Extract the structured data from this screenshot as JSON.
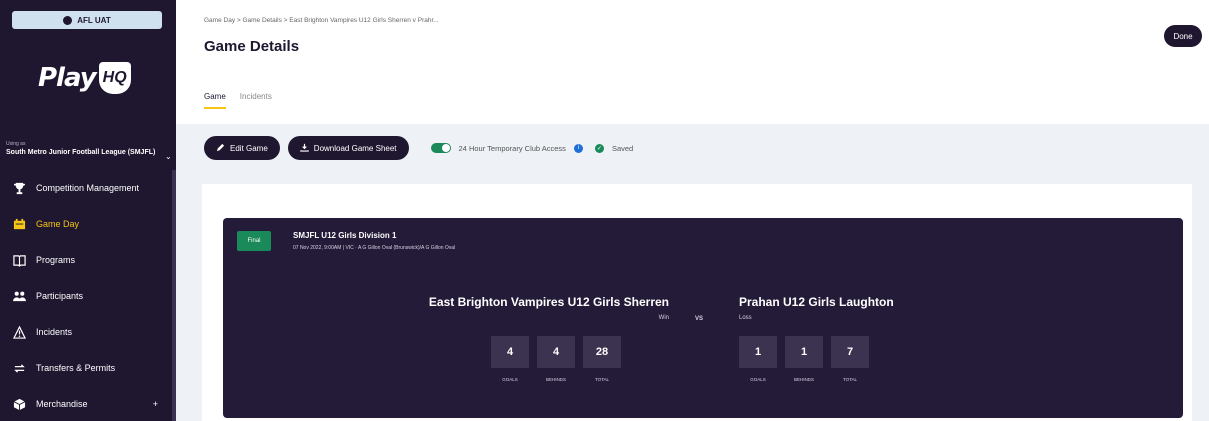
{
  "sidebar": {
    "env_label": "AFL UAT",
    "logo_text": "Play",
    "logo_badge": "HQ",
    "using_label": "Using as",
    "org_name": "South Metro Junior Football League (SMJFL)",
    "nav": [
      {
        "label": "Competition Management",
        "icon": "trophy-icon",
        "active": false
      },
      {
        "label": "Game Day",
        "icon": "game-day-icon",
        "active": true
      },
      {
        "label": "Programs",
        "icon": "book-icon",
        "active": false
      },
      {
        "label": "Participants",
        "icon": "people-icon",
        "active": false
      },
      {
        "label": "Incidents",
        "icon": "warning-icon",
        "active": false
      },
      {
        "label": "Transfers & Permits",
        "icon": "transfer-arrows-icon",
        "active": false
      },
      {
        "label": "Merchandise",
        "icon": "box-icon",
        "active": false
      }
    ],
    "merch_plus": "+"
  },
  "header": {
    "breadcrumb": "Game Day  >  Game Details  >  East Brighton Vampires U12 Girls Sherren v Prahr...",
    "title": "Game Details",
    "done_label": "Done",
    "tabs": [
      {
        "label": "Game",
        "active": true
      },
      {
        "label": "Incidents",
        "active": false
      }
    ]
  },
  "toolbar": {
    "edit_label": "Edit Game",
    "download_label": "Download Game Sheet",
    "access_label": "24 Hour Temporary Club Access",
    "saved_label": "Saved"
  },
  "game": {
    "status": "Final",
    "competition": "SMJFL U12 Girls Division 1",
    "meta": "07 Nov 2022, 9:00AM | VIC · A G Gillon Oval (Brunswick)/A G Gillon Oval",
    "vs": "VS",
    "home": {
      "name": "East Brighton Vampires U12 Girls Sherren",
      "result": "Win",
      "goals": "4",
      "behinds": "4",
      "total": "28"
    },
    "away": {
      "name": "Prahan U12 Girls Laughton",
      "result": "Loss",
      "goals": "1",
      "behinds": "1",
      "total": "7"
    },
    "labels": {
      "goals": "GOALS",
      "behinds": "BEHINDS",
      "total": "TOTAL"
    }
  },
  "colors": {
    "brand_dark": "#1f1730",
    "card_bg": "#241b38",
    "accent_yellow": "#f5c518",
    "success_green": "#1b8a5a",
    "info_blue": "#1f6fd6"
  }
}
